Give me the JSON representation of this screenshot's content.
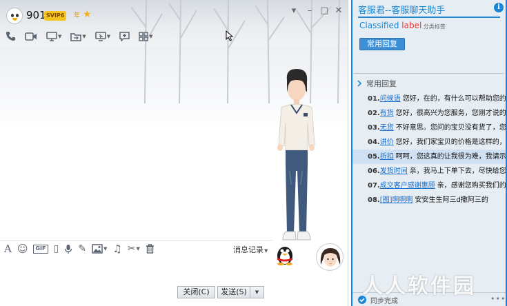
{
  "header": {
    "contact_name": "901",
    "vip_badge": "SVIP6",
    "year_tag": "年"
  },
  "window_controls": {
    "menu": "▾",
    "minimize": "–",
    "maximize": "□",
    "close": "✕"
  },
  "toolbar_top": [
    {
      "icon": "phone-icon"
    },
    {
      "icon": "video-icon"
    },
    {
      "icon": "screen-share-icon",
      "dropdown": true
    },
    {
      "icon": "file-transfer-icon",
      "dropdown": true
    },
    {
      "icon": "remote-desktop-icon",
      "dropdown": true
    },
    {
      "icon": "chat-bubble-icon"
    },
    {
      "icon": "apps-grid-icon",
      "dropdown": true
    }
  ],
  "toolbar_bottom": [
    {
      "icon": "font-icon",
      "glyph": "A"
    },
    {
      "icon": "emoji-icon",
      "glyph": "☺"
    },
    {
      "icon": "gif-icon",
      "glyph": "GIF"
    },
    {
      "icon": "shake-icon",
      "glyph": "▯"
    },
    {
      "icon": "microphone-icon",
      "glyph": "🎙"
    },
    {
      "icon": "pen-icon",
      "glyph": "✎"
    },
    {
      "icon": "image-icon",
      "glyph": "▨"
    },
    {
      "icon": "music-icon",
      "glyph": "♫"
    },
    {
      "icon": "scissors-icon",
      "glyph": "✂"
    },
    {
      "icon": "trash-icon",
      "glyph": "▥"
    }
  ],
  "history_label": "消息记录",
  "buttons": {
    "close": "关闭(C)",
    "send": "发送(S)"
  },
  "panel": {
    "title": "客服君--客服聊天助手",
    "subtitle_a": "Classified ",
    "subtitle_b": "label",
    "subtitle_c": " 分类标签",
    "quick_button": "常用回复",
    "section_title": "常用回复",
    "status": "同步完成",
    "more": "•••"
  },
  "replies": [
    {
      "num": "01.",
      "key": "问候语",
      "text": "您好，在的，有什么可以帮助您的"
    },
    {
      "num": "02.",
      "key": "有货",
      "text": "您好，很高兴为您服务，您刚才说的"
    },
    {
      "num": "03.",
      "key": "无货",
      "text": "不好意思。您问的宝贝没有货了，您"
    },
    {
      "num": "04.",
      "key": "讲价",
      "text": "您好，我们家宝贝的价格是这样的，"
    },
    {
      "num": "05.",
      "key": "折扣",
      "text": "呵呵，您这真的让我很为难，我请示"
    },
    {
      "num": "06.",
      "key": "发货时间",
      "text": "亲，我马上下单下去，尽快给您"
    },
    {
      "num": "07.",
      "key": "成交客户感谢惠顾",
      "text": "亲，感谢您购买我们的"
    },
    {
      "num": "08.",
      "key": "[图]啊啊啊",
      "text": "安安生生阿三d撒阿三的"
    }
  ],
  "selected_reply_index": 4,
  "watermark": "人人软件园",
  "colors": {
    "accent": "#1a87d6",
    "panel_border": "#0a84ff",
    "label_red": "#ee3333"
  }
}
